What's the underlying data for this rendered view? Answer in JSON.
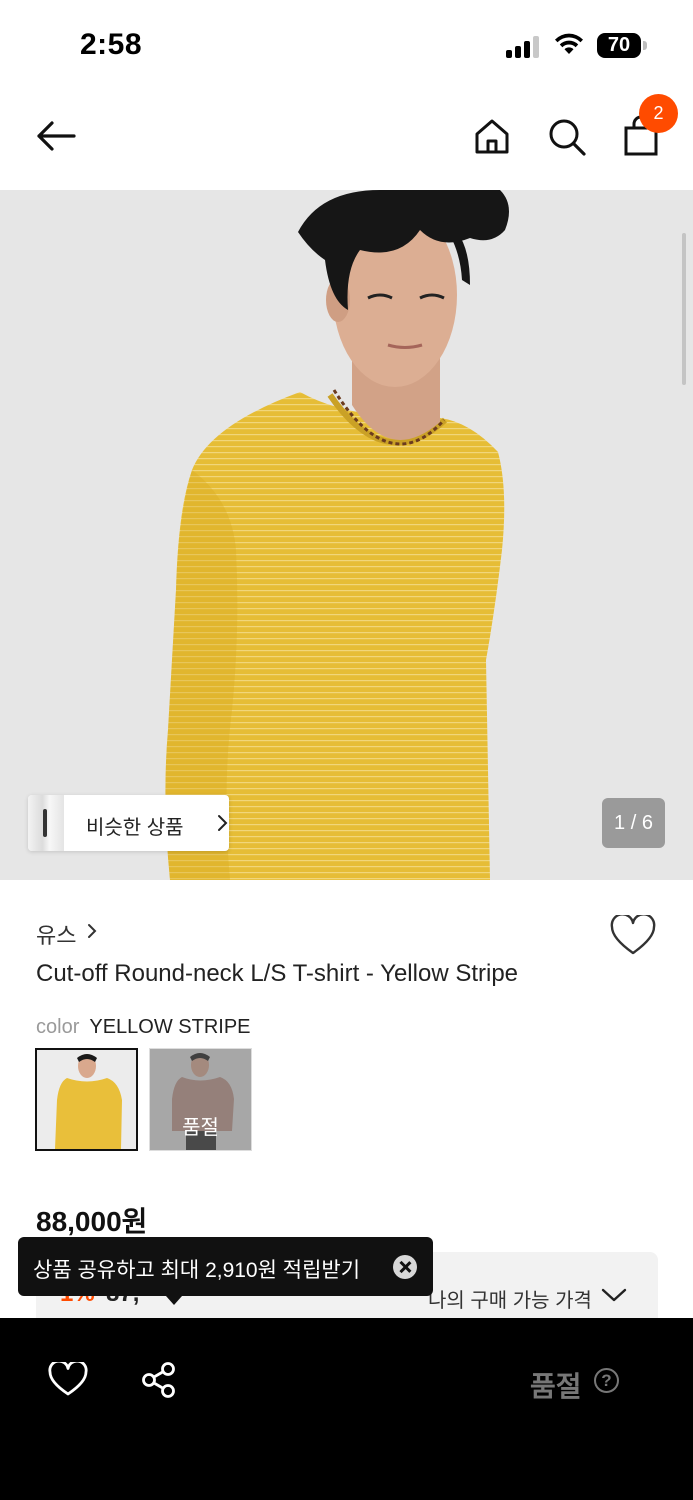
{
  "status_bar": {
    "time": "2:58",
    "battery": "70"
  },
  "header": {
    "cart_count": "2"
  },
  "hero": {
    "similar_label": "비슷한 상품",
    "page_counter": "1 / 6"
  },
  "product": {
    "brand": "유스",
    "title": "Cut-off Round-neck L/S T-shirt - Yellow Stripe",
    "color_label": "color",
    "color_value": "YELLOW STRIPE",
    "swatches": [
      {
        "name": "yellow-stripe",
        "color": "#e9bf3a",
        "sold_out": false
      },
      {
        "name": "pink",
        "color": "#b58e84",
        "sold_out": true,
        "sold_out_label": "품절"
      }
    ],
    "price": "88,000원",
    "my_price_label": "나의 구매 가능 가격",
    "hidden_discount": "1%",
    "hidden_price": "87,"
  },
  "toast": {
    "text": "상품 공유하고 최대 2,910원 적립받기"
  },
  "bottom_bar": {
    "soldout_label": "품절",
    "help_label": "?"
  },
  "colors": {
    "accent": "#ff4b00",
    "bottom_bar_bg": "#000000",
    "hero_bg": "#e6e6e6"
  }
}
